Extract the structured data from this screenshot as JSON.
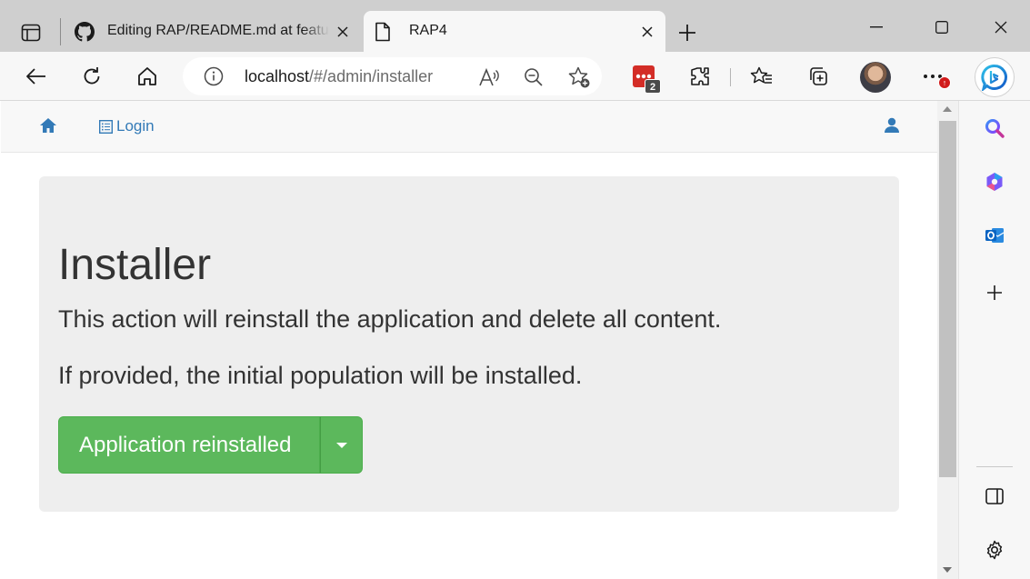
{
  "browser": {
    "tabs": [
      {
        "title": "Editing RAP/README.md at feature",
        "favicon": "github-icon",
        "active": false
      },
      {
        "title": "RAP4",
        "favicon": "page-icon",
        "active": true
      }
    ],
    "address": {
      "host": "localhost",
      "path": "/#/admin/installer"
    },
    "extension_badge": "2",
    "colors": {
      "tabbar": "#cfcfcf",
      "toolbar": "#f7f7f7",
      "accent": "#0c59a4"
    }
  },
  "sidebar": {
    "items": [
      "search-icon",
      "copilot-icon",
      "outlook-icon",
      "add-icon",
      "sidebar-toggle-icon",
      "settings-icon"
    ]
  },
  "navbar": {
    "login_label": "Login"
  },
  "page": {
    "title": "Installer",
    "line1": "This action will reinstall the application and delete all content.",
    "line2": "If provided, the initial population will be installed.",
    "button_label": "Application reinstalled",
    "colors": {
      "link": "#337ab7",
      "success": "#5cb85c",
      "jumbotron": "#eeeeee"
    }
  }
}
